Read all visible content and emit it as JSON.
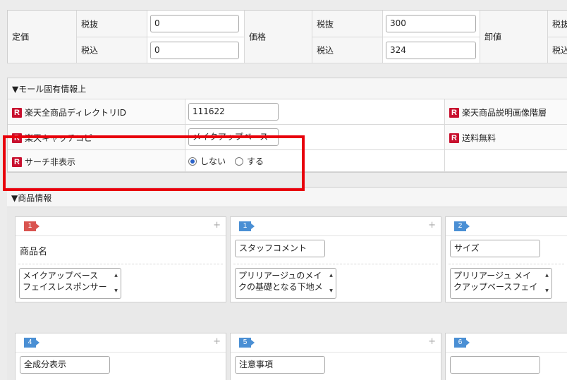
{
  "price_table": {
    "teika": {
      "label": "定価",
      "zeinuki_label": "税抜",
      "zeikomi_label": "税込",
      "zeinuki_value": "0",
      "zeikomi_value": "0"
    },
    "kakaku": {
      "label": "価格",
      "zeinuki_label": "税抜",
      "zeikomi_label": "税込",
      "zeinuki_value": "300",
      "zeikomi_value": "324"
    },
    "oroshine": {
      "label": "卸値",
      "zeinuki_label": "税抜",
      "zeikomi_label": "税込"
    }
  },
  "mall_section": {
    "title": "▼モール固有情報上",
    "rows": {
      "directory_id": {
        "icon": "R",
        "label": "楽天全商品ディレクトリID",
        "value": "111622"
      },
      "catch_copy": {
        "icon": "R",
        "label": "楽天キャッチコピ",
        "value": "メイクアップベース"
      },
      "search_hidden": {
        "icon": "R",
        "label": "サーチ非表示",
        "option_no": "しない",
        "option_yes": "する",
        "selected": "しない"
      },
      "image_hierarchy": {
        "icon": "R",
        "label": "楽天商品説明画像階層"
      },
      "free_shipping": {
        "icon": "R",
        "label": "送料無料"
      }
    }
  },
  "product_section": {
    "title": "▼商品情報",
    "cards_row1": [
      {
        "badge": "1",
        "badge_color": "#d9534f",
        "label": "商品名",
        "content": [
          "メイクアップベース",
          "フェイスレスポンサー"
        ]
      },
      {
        "badge": "1",
        "badge_color": "#4a8fd4",
        "field": "スタッフコメント",
        "content": [
          "プリリアージュのメイ",
          "クの基礎となる下地メ"
        ]
      },
      {
        "badge": "2",
        "badge_color": "#4a8fd4",
        "field": "サイズ",
        "content": [
          "プリリアージュ メイ",
          "クアップベースフェイ"
        ]
      }
    ],
    "cards_row2": [
      {
        "badge": "4",
        "badge_color": "#4a8fd4",
        "field": "全成分表示"
      },
      {
        "badge": "5",
        "badge_color": "#4a8fd4",
        "field": "注意事項"
      },
      {
        "badge": "6",
        "badge_color": "#4a8fd4",
        "field": ""
      }
    ]
  },
  "colors": {
    "highlight": "#e8000b",
    "rakuten_red": "#c8102e"
  }
}
